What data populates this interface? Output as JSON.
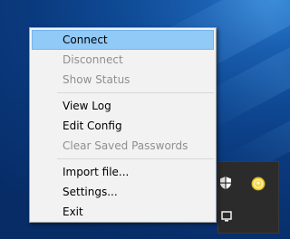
{
  "menu": {
    "groups": [
      [
        {
          "label": "Connect",
          "enabled": true,
          "highlighted": true
        },
        {
          "label": "Disconnect",
          "enabled": false
        },
        {
          "label": "Show Status",
          "enabled": false
        }
      ],
      [
        {
          "label": "View Log",
          "enabled": true
        },
        {
          "label": "Edit Config",
          "enabled": true
        },
        {
          "label": "Clear Saved Passwords",
          "enabled": false
        }
      ],
      [
        {
          "label": "Import file...",
          "enabled": true
        },
        {
          "label": "Settings...",
          "enabled": true
        },
        {
          "label": "Exit",
          "enabled": true
        }
      ]
    ]
  },
  "tray": {
    "icons": [
      "shield-icon",
      "openvpn-icon",
      "screen-icon"
    ]
  },
  "colors": {
    "highlight": "#91c9f7",
    "menu_bg": "#f2f2f2",
    "disabled_text": "#8f8f8f",
    "tray_bg": "#2b2b2b"
  }
}
